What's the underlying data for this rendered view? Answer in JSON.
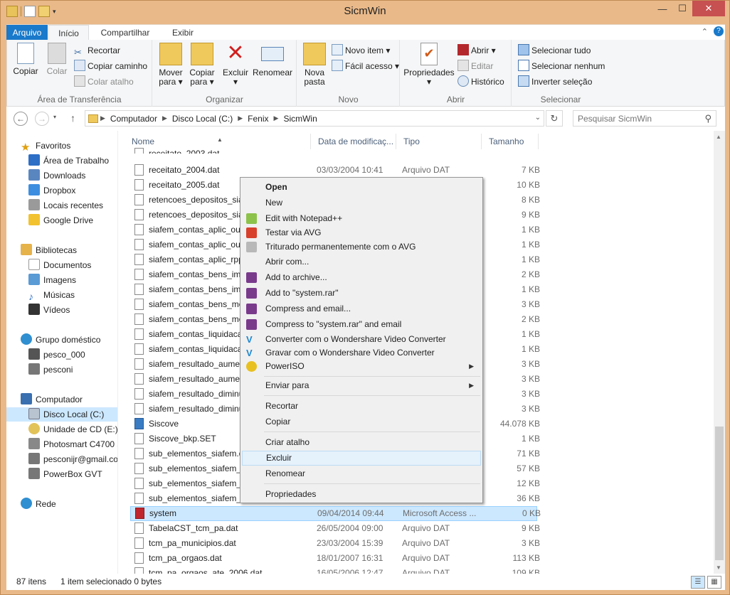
{
  "window": {
    "title": "SicmWin"
  },
  "titlebar": {
    "minimize": "—",
    "maximize": "☐",
    "close": "✕"
  },
  "ribbon_tabs": {
    "file": "Arquivo",
    "home": "Início",
    "share": "Compartilhar",
    "view": "Exibir",
    "expand": "⌃"
  },
  "ribbon": {
    "clipboard": {
      "label": "Área de Transferência",
      "copy": "Copiar",
      "paste": "Colar",
      "cut": "Recortar",
      "copy_path": "Copiar caminho",
      "paste_shortcut": "Colar atalho"
    },
    "organize": {
      "label": "Organizar",
      "move_to": "Mover para",
      "copy_to": "Copiar para",
      "delete": "Excluir",
      "rename": "Renomear"
    },
    "new": {
      "label": "Novo",
      "new_folder": "Nova pasta",
      "new_item": "Novo item",
      "easy_access": "Fácil acesso"
    },
    "open": {
      "label": "Abrir",
      "properties": "Propriedades",
      "open": "Abrir",
      "edit": "Editar",
      "history": "Histórico"
    },
    "select": {
      "label": "Selecionar",
      "select_all": "Selecionar tudo",
      "select_none": "Selecionar nenhum",
      "invert": "Inverter seleção"
    }
  },
  "address": {
    "breadcrumbs": [
      "Computador",
      "Disco Local (C:)",
      "Fenix",
      "SicmWin"
    ],
    "search_placeholder": "Pesquisar SicmWin"
  },
  "nav_pane": {
    "favorites": {
      "label": "Favoritos",
      "items": [
        "Área de Trabalho",
        "Downloads",
        "Dropbox",
        "Locais recentes",
        "Google Drive"
      ]
    },
    "libraries": {
      "label": "Bibliotecas",
      "items": [
        "Documentos",
        "Imagens",
        "Músicas",
        "Vídeos"
      ]
    },
    "homegroup": {
      "label": "Grupo doméstico",
      "items": [
        "pesco_000",
        "pesconi"
      ]
    },
    "computer": {
      "label": "Computador",
      "items": [
        "Disco Local (C:)",
        "Unidade de CD (E:) V",
        "Photosmart C4700 s",
        "pesconijr@gmail.co",
        "PowerBox GVT"
      ]
    },
    "network": {
      "label": "Rede"
    }
  },
  "columns": {
    "name": "Nome",
    "date": "Data de modificaç...",
    "type": "Tipo",
    "size": "Tamanho"
  },
  "files": [
    {
      "name": "receitato_2003.dat",
      "date": "24/03/2004 10:39",
      "type": "Arquivo DAT",
      "size": "4 KB"
    },
    {
      "name": "receitato_2004.dat",
      "date": "03/03/2004 10:41",
      "type": "Arquivo DAT",
      "size": "7 KB"
    },
    {
      "name": "receitato_2005.dat",
      "date": "22/02/2005 12:59",
      "type": "Arquivo DAT",
      "size": "10 KB"
    },
    {
      "name": "retencoes_depositos_siafem",
      "date": "",
      "type": "",
      "size": "8 KB"
    },
    {
      "name": "retencoes_depositos_siafem",
      "date": "",
      "type": "",
      "size": "9 KB"
    },
    {
      "name": "siafem_contas_aplic_outras",
      "date": "",
      "type": "",
      "size": "1 KB"
    },
    {
      "name": "siafem_contas_aplic_outras",
      "date": "",
      "type": "",
      "size": "1 KB"
    },
    {
      "name": "siafem_contas_aplic_rpps",
      "date": "",
      "type": "",
      "size": "1 KB"
    },
    {
      "name": "siafem_contas_bens_imoveis",
      "date": "",
      "type": "",
      "size": "2 KB"
    },
    {
      "name": "siafem_contas_bens_imoveis",
      "date": "",
      "type": "",
      "size": "1 KB"
    },
    {
      "name": "siafem_contas_bens_moveis",
      "date": "",
      "type": "",
      "size": "3 KB"
    },
    {
      "name": "siafem_contas_bens_moveis",
      "date": "",
      "type": "",
      "size": "2 KB"
    },
    {
      "name": "siafem_contas_liquidacao",
      "date": "",
      "type": "",
      "size": "1 KB"
    },
    {
      "name": "siafem_contas_liquidacao",
      "date": "",
      "type": "",
      "size": "1 KB"
    },
    {
      "name": "siafem_resultado_aumento",
      "date": "",
      "type": "",
      "size": "3 KB"
    },
    {
      "name": "siafem_resultado_aumento",
      "date": "",
      "type": "",
      "size": "3 KB"
    },
    {
      "name": "siafem_resultado_diminuicao",
      "date": "",
      "type": "",
      "size": "3 KB"
    },
    {
      "name": "siafem_resultado_diminuicao",
      "date": "",
      "type": "",
      "size": "3 KB"
    },
    {
      "name": "Siscove",
      "date": "",
      "type": "",
      "size": "44.078 KB"
    },
    {
      "name": "Siscove_bkp.SET",
      "date": "",
      "type": "",
      "size": "1 KB"
    },
    {
      "name": "sub_elementos_siafem.dat",
      "date": "",
      "type": "",
      "size": "71 KB"
    },
    {
      "name": "sub_elementos_siafem_atual",
      "date": "",
      "type": "",
      "size": "57 KB"
    },
    {
      "name": "sub_elementos_siafem_rpps",
      "date": "",
      "type": "",
      "size": "12 KB"
    },
    {
      "name": "sub_elementos_siafem_todos",
      "date": "",
      "type": "",
      "size": "36 KB"
    },
    {
      "name": "system",
      "date": "09/04/2014 09:44",
      "type": "Microsoft Access ...",
      "size": "0 KB"
    },
    {
      "name": "TabelaCST_tcm_pa.dat",
      "date": "26/05/2004 09:00",
      "type": "Arquivo DAT",
      "size": "9 KB"
    },
    {
      "name": "tcm_pa_municipios.dat",
      "date": "23/03/2004 15:39",
      "type": "Arquivo DAT",
      "size": "3 KB"
    },
    {
      "name": "tcm_pa_orgaos.dat",
      "date": "18/01/2007 16:31",
      "type": "Arquivo DAT",
      "size": "113 KB"
    },
    {
      "name": "tcm_pa_orgaos_ate_2006.dat",
      "date": "16/05/2006 12:47",
      "type": "Arquivo DAT",
      "size": "109 KB"
    }
  ],
  "context_menu": {
    "open": "Open",
    "new": "New",
    "notepad": "Edit with Notepad++",
    "avg_test": "Testar via  AVG",
    "avg_shred": "Triturado permanentemente com o AVG",
    "open_with": "Abrir com...",
    "add_archive": "Add to archive...",
    "add_rar": "Add to \"system.rar\"",
    "compress_email": "Compress and email...",
    "compress_rar_email": "Compress to \"system.rar\" and email",
    "wondershare_convert": "Converter com o Wondershare Video Converter",
    "wondershare_burn": "Gravar com o Wondershare Video Converter",
    "poweriso": "PowerISO",
    "send_to": "Enviar para",
    "cut": "Recortar",
    "copy": "Copiar",
    "shortcut": "Criar atalho",
    "delete": "Excluir",
    "rename": "Renomear",
    "properties": "Propriedades"
  },
  "status": {
    "count": "87 itens",
    "selected": "1 item selecionado 0 bytes"
  },
  "colors": {
    "accent": "#1979ca",
    "frame": "#e9b989",
    "selection": "#cce8ff"
  }
}
